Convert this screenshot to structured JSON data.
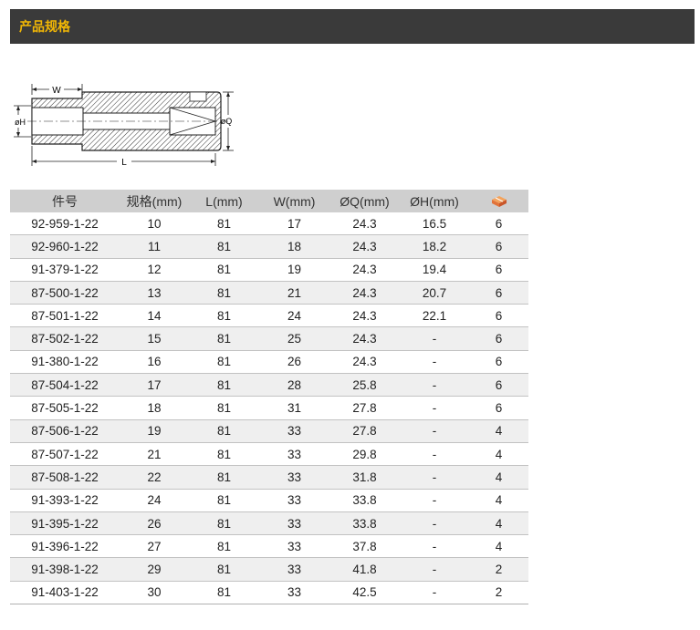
{
  "header": {
    "title": "产品规格"
  },
  "diagram": {
    "w_label": "W",
    "h_label": "øH",
    "q_label": "øQ",
    "l_label": "L"
  },
  "table": {
    "columns": [
      "件号",
      "规格(mm)",
      "L(mm)",
      "W(mm)",
      "ØQ(mm)",
      "ØH(mm)"
    ],
    "last_column_icon": "package-box-icon",
    "rows": [
      [
        "92-959-1-22",
        "10",
        "81",
        "17",
        "24.3",
        "16.5",
        "6"
      ],
      [
        "92-960-1-22",
        "11",
        "81",
        "18",
        "24.3",
        "18.2",
        "6"
      ],
      [
        "91-379-1-22",
        "12",
        "81",
        "19",
        "24.3",
        "19.4",
        "6"
      ],
      [
        "87-500-1-22",
        "13",
        "81",
        "21",
        "24.3",
        "20.7",
        "6"
      ],
      [
        "87-501-1-22",
        "14",
        "81",
        "24",
        "24.3",
        "22.1",
        "6"
      ],
      [
        "87-502-1-22",
        "15",
        "81",
        "25",
        "24.3",
        "-",
        "6"
      ],
      [
        "91-380-1-22",
        "16",
        "81",
        "26",
        "24.3",
        "-",
        "6"
      ],
      [
        "87-504-1-22",
        "17",
        "81",
        "28",
        "25.8",
        "-",
        "6"
      ],
      [
        "87-505-1-22",
        "18",
        "81",
        "31",
        "27.8",
        "-",
        "6"
      ],
      [
        "87-506-1-22",
        "19",
        "81",
        "33",
        "27.8",
        "-",
        "4"
      ],
      [
        "87-507-1-22",
        "21",
        "81",
        "33",
        "29.8",
        "-",
        "4"
      ],
      [
        "87-508-1-22",
        "22",
        "81",
        "33",
        "31.8",
        "-",
        "4"
      ],
      [
        "91-393-1-22",
        "24",
        "81",
        "33",
        "33.8",
        "-",
        "4"
      ],
      [
        "91-395-1-22",
        "26",
        "81",
        "33",
        "33.8",
        "-",
        "4"
      ],
      [
        "91-396-1-22",
        "27",
        "81",
        "33",
        "37.8",
        "-",
        "4"
      ],
      [
        "91-398-1-22",
        "29",
        "81",
        "33",
        "41.8",
        "-",
        "2"
      ],
      [
        "91-403-1-22",
        "30",
        "81",
        "33",
        "42.5",
        "-",
        "2"
      ]
    ]
  }
}
